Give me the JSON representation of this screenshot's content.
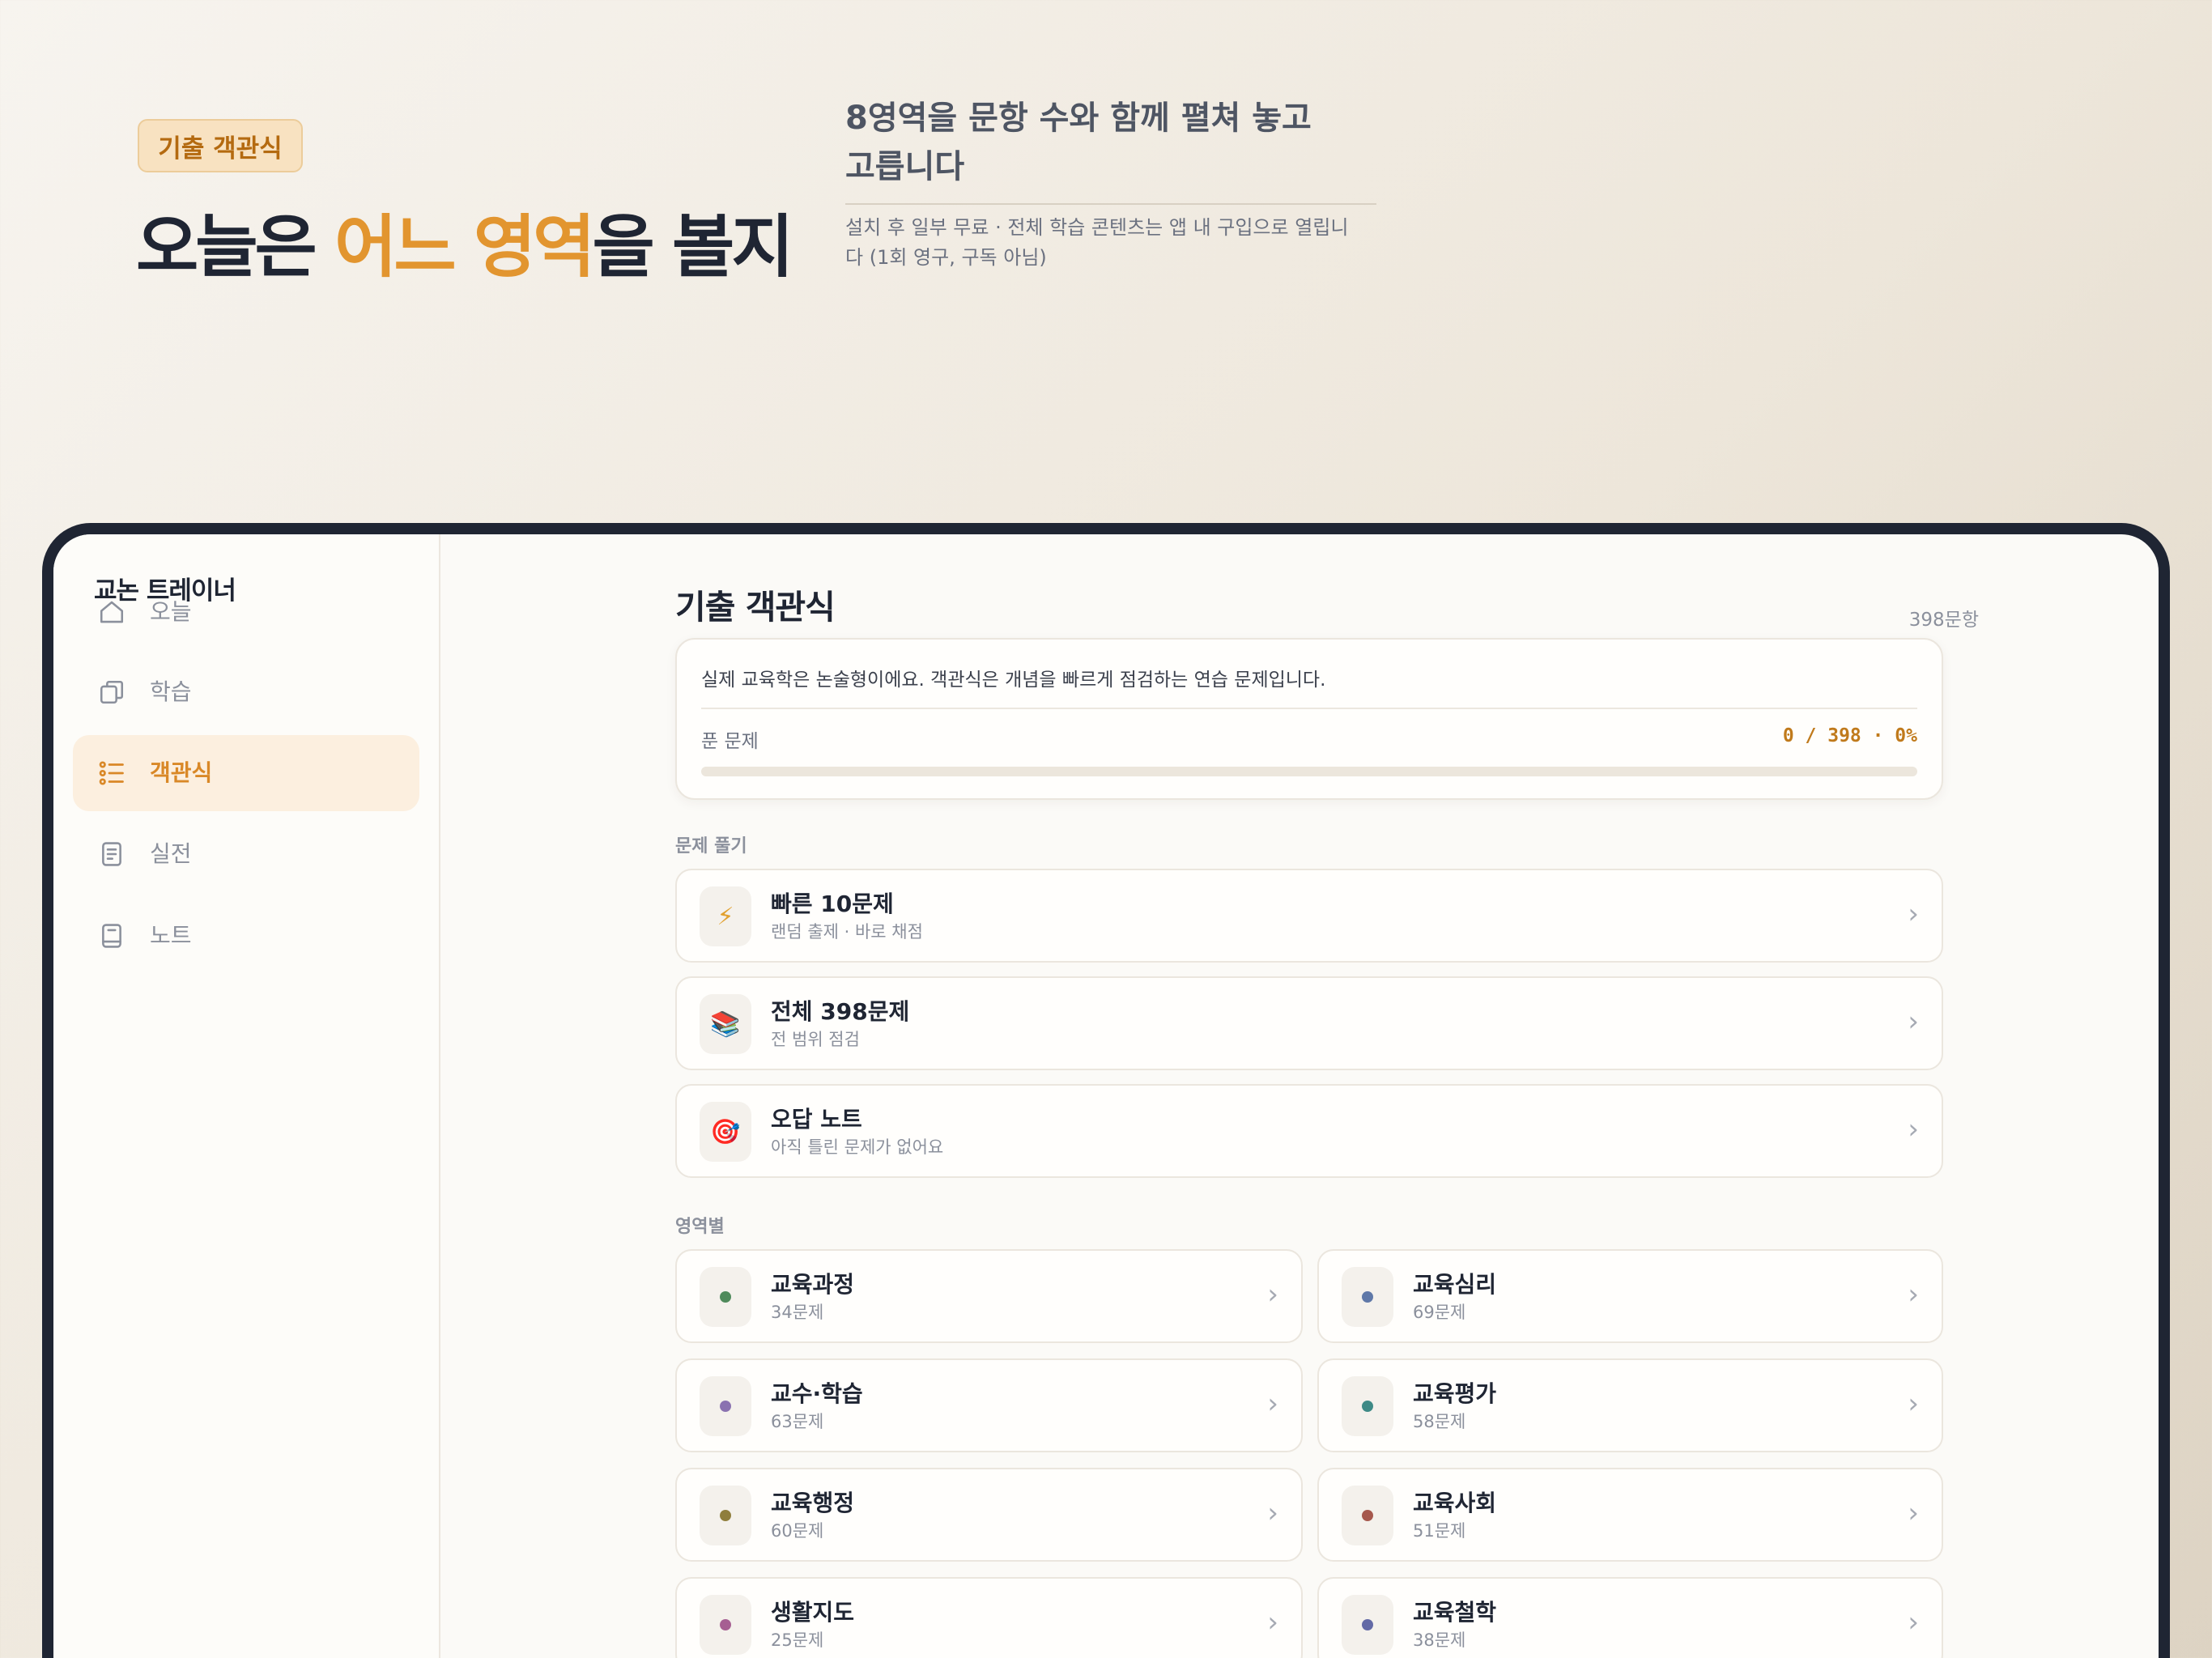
{
  "hero": {
    "badge": "기출 객관식",
    "title_part1": "오늘은 ",
    "title_accent": "어느 영역",
    "title_part2": "을 볼지",
    "subtitle": "8영역을 문항 수와 함께 펼쳐 놓고 고릅니다",
    "note": "설치 후 일부 무료 · 전체 학습 콘텐츠는 앱 내 구입으로 열립니다 (1회 영구, 구독 아님)"
  },
  "app": {
    "title": "교논 트레이너"
  },
  "sidebar": {
    "items": [
      {
        "label": "오늘",
        "icon": "home-icon",
        "active": false
      },
      {
        "label": "학습",
        "icon": "cards-icon",
        "active": false
      },
      {
        "label": "객관식",
        "icon": "list-icon",
        "active": true
      },
      {
        "label": "실전",
        "icon": "document-icon",
        "active": false
      },
      {
        "label": "노트",
        "icon": "notebook-icon",
        "active": false
      }
    ]
  },
  "main": {
    "title": "기출 객관식",
    "count": "398문항",
    "progress": {
      "description": "실제 교육학은 논술형이에요. 객관식은 개념을 빠르게 점검하는 연습 문제입니다.",
      "label": "푼 문제",
      "value_text": "0 / 398 · 0%",
      "fraction": 0
    },
    "practice_section": "문제 풀기",
    "practice": [
      {
        "title": "빠른 10문제",
        "subtitle": "랜덤 출제 · 바로 채점",
        "icon": "lightning-icon",
        "glyph": "⚡"
      },
      {
        "title": "전체 398문제",
        "subtitle": "전 범위 점검",
        "icon": "books-icon",
        "glyph": "📚"
      },
      {
        "title": "오답 노트",
        "subtitle": "아직 틀린 문제가 없어요",
        "icon": "target-icon",
        "glyph": "🎯"
      }
    ],
    "domain_section": "영역별",
    "domains": [
      {
        "title": "교육과정",
        "subtitle": "34문제",
        "color": "#4f8a5b"
      },
      {
        "title": "교육심리",
        "subtitle": "69문제",
        "color": "#5f78a8"
      },
      {
        "title": "교수·학습",
        "subtitle": "63문제",
        "color": "#8a72b0"
      },
      {
        "title": "교육평가",
        "subtitle": "58문제",
        "color": "#3e8a86"
      },
      {
        "title": "교육행정",
        "subtitle": "60문제",
        "color": "#8f7e3c"
      },
      {
        "title": "교육사회",
        "subtitle": "51문제",
        "color": "#a6584d"
      },
      {
        "title": "생활지도",
        "subtitle": "25문제",
        "color": "#a65f92"
      },
      {
        "title": "교육철학",
        "subtitle": "38문제",
        "color": "#636aa6"
      }
    ],
    "chevron": "›"
  }
}
